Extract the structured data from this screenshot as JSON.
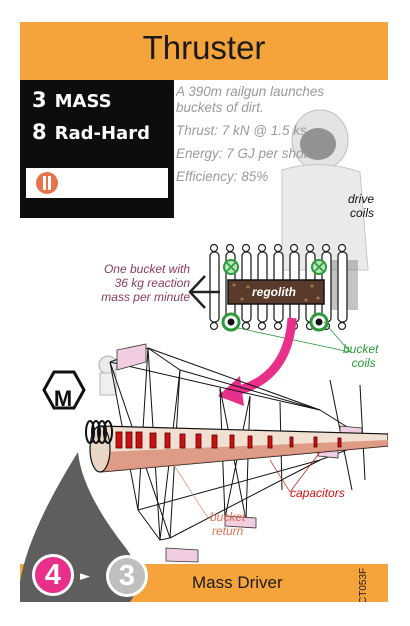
{
  "card": {
    "title": "Thruster",
    "stats": {
      "mass_value": "3",
      "mass_label": "MASS",
      "radhard_value": "8",
      "radhard_label": "Rad-Hard",
      "icon": "pause-circle-icon"
    },
    "description": [
      "A 390m railgun launches",
      "buckets of dirt.",
      "Thrust: 7 kN @ 1.5 ks",
      "Energy: 7 GJ per shot",
      "Efficiency: 85%"
    ],
    "diagram_labels": {
      "drive_coils_1": "drive",
      "drive_coils_2": "coils",
      "reaction_1": "One bucket with",
      "reaction_2": "36 kg reaction",
      "reaction_3": "mass per minute",
      "regolith": "regolith",
      "bucket_coils_1": "bucket",
      "bucket_coils_2": "coils",
      "capacitors": "capacitors",
      "bucket_return_1": "bucket",
      "bucket_return_2": "return"
    },
    "badge_letter": "M",
    "cost_in": "4",
    "cost_out": "3",
    "footer_name": "Mass Driver",
    "code": "CT053F",
    "colors": {
      "header": "#f5a43b",
      "pink": "#e8308a",
      "label_purple": "#8a3a5a",
      "green": "#2a9a3a",
      "red": "#cc1111"
    }
  }
}
